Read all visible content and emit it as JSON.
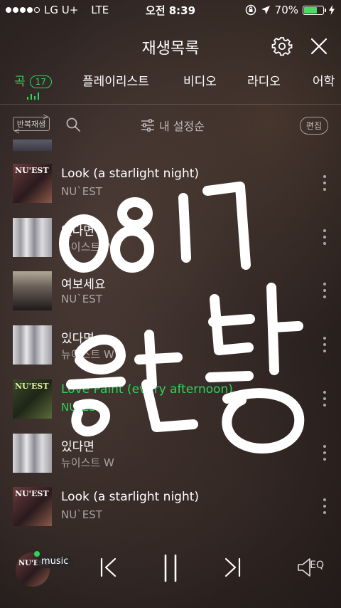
{
  "status_bar": {
    "carrier": "LG U+",
    "network": "LTE",
    "time": "오전 8:39",
    "battery_percent": "70%",
    "battery_level": 0.7
  },
  "header": {
    "title": "재생목록"
  },
  "tabs": [
    {
      "label": "곡",
      "count": "17",
      "active": true
    },
    {
      "label": "플레이리스트",
      "active": false
    },
    {
      "label": "비디오",
      "active": false
    },
    {
      "label": "라디오",
      "active": false
    },
    {
      "label": "어학",
      "active": false
    }
  ],
  "toolbar": {
    "repeat_label": "반복재생",
    "sort_label": "내 설정순",
    "edit_label": "편집"
  },
  "tracks": [
    {
      "title": "Look (a starlight night)",
      "artist": "NU`EST",
      "cover": "nuest-look",
      "playing": false
    },
    {
      "title": "있다면",
      "artist": "뉴이스트 W",
      "cover": "nuest-w",
      "playing": false
    },
    {
      "title": "여보세요",
      "artist": "NU`EST",
      "cover": "nuest-hello",
      "playing": false
    },
    {
      "title": "있다면",
      "artist": "뉴이스트 W",
      "cover": "nuest-w",
      "playing": false
    },
    {
      "title": "Love Paint (every afternoon)",
      "artist": "NU`EST",
      "cover": "nuest-lovepaint",
      "playing": true
    },
    {
      "title": "있다면",
      "artist": "뉴이스트 W",
      "cover": "nuest-w",
      "playing": false
    },
    {
      "title": "Look (a starlight night)",
      "artist": "NU`EST",
      "cover": "nuest-look",
      "playing": false
    }
  ],
  "player": {
    "badge": "music",
    "eq_label": "EQ"
  },
  "colors": {
    "accent": "#2bd65a"
  }
}
